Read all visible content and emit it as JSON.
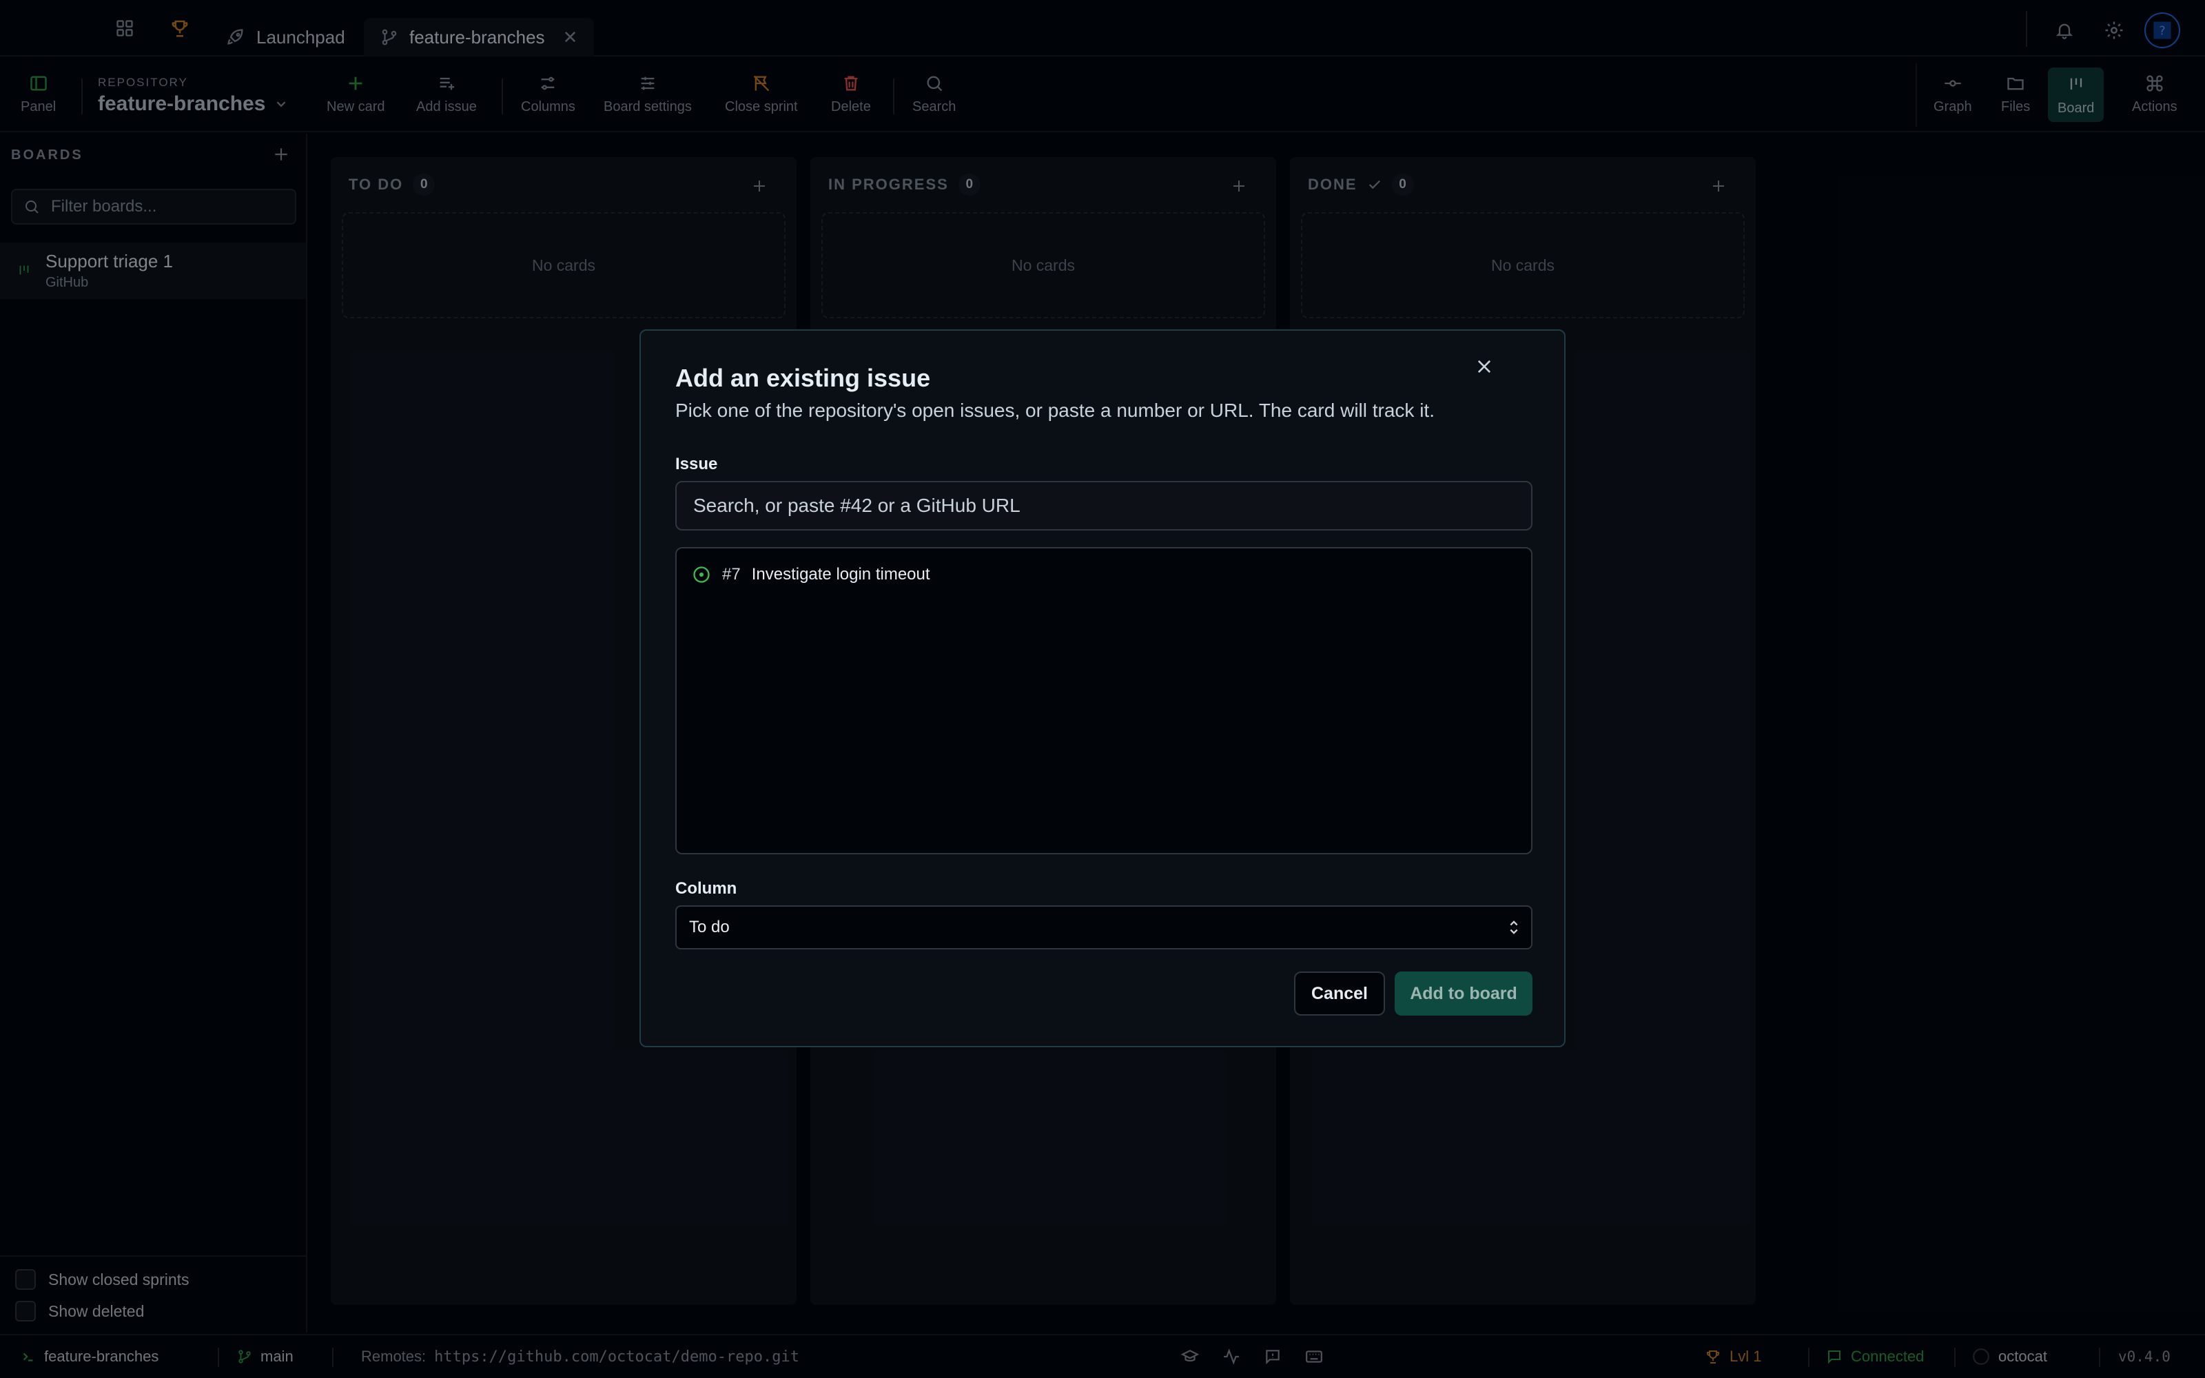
{
  "colors": {
    "accent": "#2ea043",
    "orange": "#d4801c",
    "danger": "#f85149"
  },
  "tabs": [
    {
      "label": "Launchpad"
    },
    {
      "label": "feature-branches"
    }
  ],
  "toolbar": {
    "panel": "Panel",
    "repo_label": "REPOSITORY",
    "repo_name": "feature-branches",
    "new_card": "New card",
    "add_issue": "Add issue",
    "columns": "Columns",
    "board_settings": "Board settings",
    "close_sprint": "Close sprint",
    "delete": "Delete",
    "search": "Search",
    "graph": "Graph",
    "files": "Files",
    "board": "Board",
    "actions": "Actions"
  },
  "sidebar": {
    "heading": "BOARDS",
    "filter_placeholder": "Filter boards...",
    "boards": [
      {
        "name": "Support triage 1",
        "provider": "GitHub"
      }
    ],
    "show_closed": "Show closed sprints",
    "show_deleted": "Show deleted"
  },
  "columns": [
    {
      "title": "TO DO",
      "count": "0",
      "empty": "No cards"
    },
    {
      "title": "IN PROGRESS",
      "count": "0",
      "empty": "No cards"
    },
    {
      "title": "DONE",
      "count": "0",
      "empty": "No cards"
    }
  ],
  "modal": {
    "title": "Add an existing issue",
    "subtitle": "Pick one of the repository's open issues, or paste a number or URL. The card will track it.",
    "issue_label": "Issue",
    "issue_placeholder": "Search, or paste #42 or a GitHub URL",
    "issues": [
      {
        "number": "#7",
        "title": "Investigate login timeout"
      }
    ],
    "column_label": "Column",
    "column_value": "To do",
    "cancel": "Cancel",
    "submit": "Add to board"
  },
  "status": {
    "repo": "feature-branches",
    "branch": "main",
    "remotes_label": "Remotes:",
    "remote_url": "https://github.com/octocat/demo-repo.git",
    "level": "Lvl 1",
    "connection": "Connected",
    "user": "octocat",
    "version": "v0.4.0"
  }
}
